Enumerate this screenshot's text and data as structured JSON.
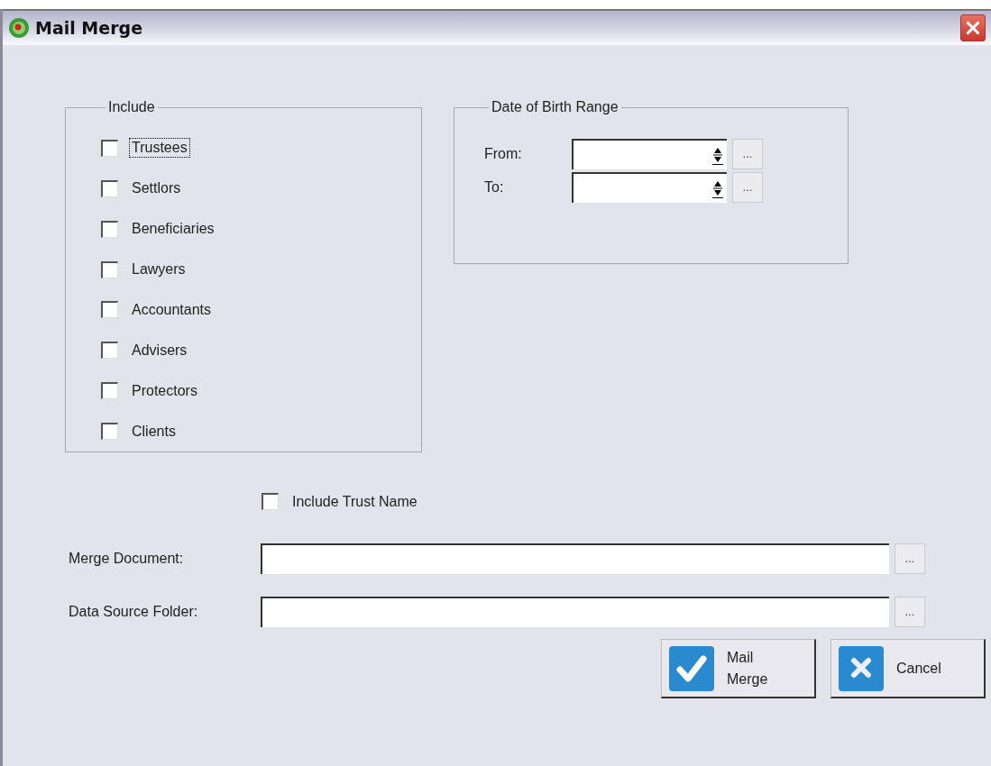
{
  "window": {
    "title": "Mail Merge"
  },
  "include_group": {
    "title": "Include",
    "options": [
      {
        "label": "Trustees",
        "checked": false,
        "focused": true
      },
      {
        "label": "Settlors",
        "checked": false,
        "focused": false
      },
      {
        "label": "Beneficiaries",
        "checked": false,
        "focused": false
      },
      {
        "label": "Lawyers",
        "checked": false,
        "focused": false
      },
      {
        "label": "Accountants",
        "checked": false,
        "focused": false
      },
      {
        "label": "Advisers",
        "checked": false,
        "focused": false
      },
      {
        "label": "Protectors",
        "checked": false,
        "focused": false
      },
      {
        "label": "Clients",
        "checked": false,
        "focused": false
      }
    ]
  },
  "date_group": {
    "title": "Date of Birth Range",
    "fields": [
      {
        "label": "From:",
        "browse": "..."
      },
      {
        "label": "To:",
        "browse": "..."
      }
    ]
  },
  "include_trust_name": {
    "label": "Include Trust Name",
    "checked": false
  },
  "paths": [
    {
      "label": "Merge Document:",
      "browse": "..."
    },
    {
      "label": "Data Source Folder:",
      "browse": "..."
    }
  ],
  "buttons": [
    {
      "kind": "ok",
      "label": "Mail\nMerge"
    },
    {
      "kind": "cancel",
      "label": "Cancel"
    }
  ]
}
